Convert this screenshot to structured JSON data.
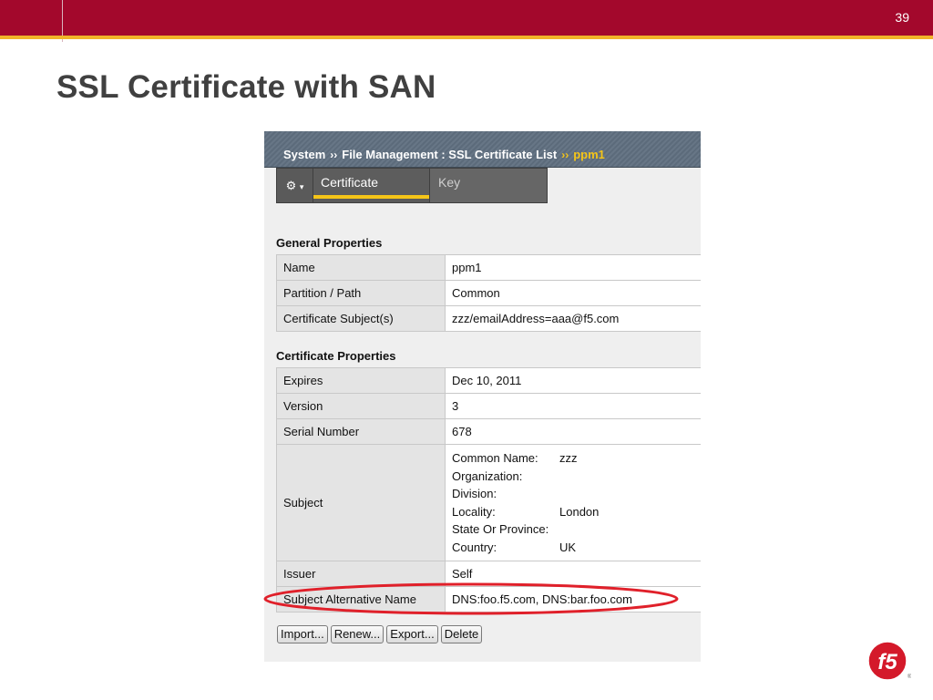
{
  "slide": {
    "number": "39",
    "title": "SSL Certificate with SAN"
  },
  "breadcrumb": {
    "items": [
      "System",
      "File Management : SSL Certificate List"
    ],
    "separator": "››",
    "current": "ppm1"
  },
  "tabs": {
    "menu_icon": "gear-icon",
    "items": [
      {
        "label": "Certificate",
        "active": true
      },
      {
        "label": "Key",
        "active": false
      }
    ]
  },
  "general": {
    "title": "General Properties",
    "rows": [
      {
        "label": "Name",
        "value": "ppm1"
      },
      {
        "label": "Partition / Path",
        "value": "Common"
      },
      {
        "label": "Certificate Subject(s)",
        "value": "zzz/emailAddress=aaa@f5.com"
      }
    ]
  },
  "certificate": {
    "title": "Certificate Properties",
    "rows": [
      {
        "label": "Expires",
        "value": "Dec 10, 2011"
      },
      {
        "label": "Version",
        "value": "3"
      },
      {
        "label": "Serial Number",
        "value": "678"
      }
    ],
    "subject": {
      "label": "Subject",
      "fields": [
        {
          "key": "Common Name:",
          "value": "zzz"
        },
        {
          "key": "Organization:",
          "value": ""
        },
        {
          "key": "Division:",
          "value": ""
        },
        {
          "key": "Locality:",
          "value": "London"
        },
        {
          "key": "State Or Province:",
          "value": ""
        },
        {
          "key": "Country:",
          "value": "UK"
        }
      ]
    },
    "issuer": {
      "label": "Issuer",
      "value": "Self"
    },
    "san": {
      "label": "Subject Alternative Name",
      "value": "DNS:foo.f5.com, DNS:bar.foo.com"
    }
  },
  "buttons": {
    "import": "Import...",
    "renew": "Renew...",
    "export": "Export...",
    "delete": "Delete"
  },
  "colors": {
    "brand_bar": "#a3082c",
    "accent_stripe": "#f0b429",
    "highlight_oval": "#e0202a",
    "tab_active": "#f5c518"
  },
  "logo": {
    "text": "f5",
    "icon": "f5-logo-icon"
  }
}
